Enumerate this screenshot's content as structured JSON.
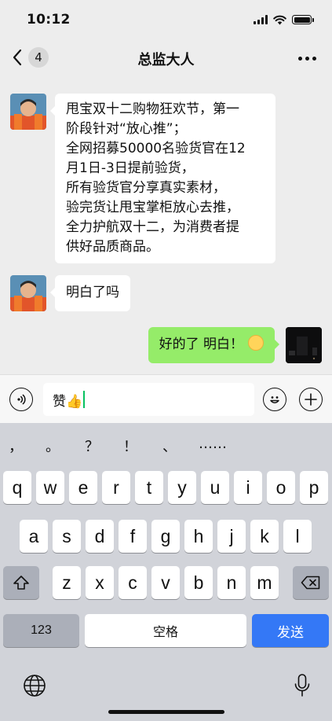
{
  "status": {
    "time": "10:12"
  },
  "nav": {
    "back_count": "4",
    "title": "总监大人"
  },
  "messages": [
    {
      "side": "left",
      "lines": [
        "甩宝双十二购物狂欢节，第一",
        "阶段针对“放心推”；",
        "全网招募50000名验货官在12",
        "月1日-3日提前验货，",
        "所有验货官分享真实素材，",
        "验完货让甩宝掌柜放心去推，",
        "全力护航双十二，为消费者提",
        "供好品质商品。"
      ]
    },
    {
      "side": "left",
      "text": "明白了吗"
    },
    {
      "side": "right",
      "text": "好的了 明白！",
      "emoji": "smiling-face"
    }
  ],
  "input": {
    "value": "赞👍"
  },
  "keyboard": {
    "punctuation": [
      "，",
      "。",
      "？",
      "！",
      "、",
      "……"
    ],
    "row1": [
      "q",
      "w",
      "e",
      "r",
      "t",
      "y",
      "u",
      "i",
      "o",
      "p"
    ],
    "row2": [
      "a",
      "s",
      "d",
      "f",
      "g",
      "h",
      "j",
      "k",
      "l"
    ],
    "row3": [
      "z",
      "x",
      "c",
      "v",
      "b",
      "n",
      "m"
    ],
    "numbers_label": "123",
    "space_label": "空格",
    "send_label": "发送"
  },
  "colors": {
    "sent_bubble": "#95ec69",
    "send_key": "#3478f6",
    "caret": "#07c160"
  }
}
